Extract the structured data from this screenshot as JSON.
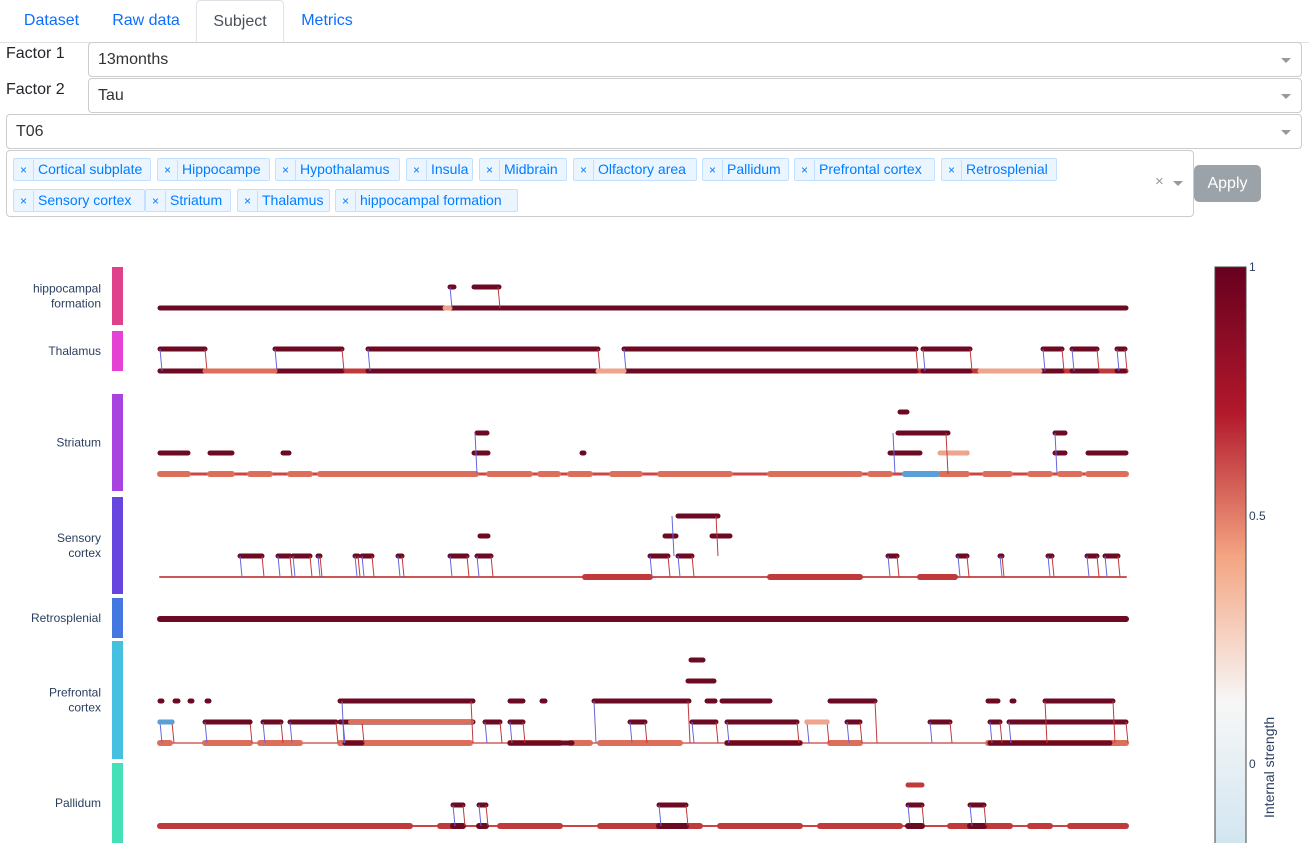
{
  "tabs": [
    {
      "label": "Dataset",
      "active": false
    },
    {
      "label": "Raw data",
      "active": false
    },
    {
      "label": "Subject",
      "active": true
    },
    {
      "label": "Metrics",
      "active": false
    }
  ],
  "filters": {
    "factor1": {
      "label": "Factor 1",
      "value": "13months"
    },
    "factor2": {
      "label": "Factor 2",
      "value": "Tau"
    },
    "subject": {
      "value": "T06"
    }
  },
  "regions": {
    "chips": [
      "Cortical subplate",
      "Hippocampe",
      "Hypothalamus",
      "Insula",
      "Midbrain",
      "Olfactory area",
      "Pallidum",
      "Prefrontal cortex",
      "Retrosplenial",
      "Sensory cortex",
      "Striatum",
      "Thalamus",
      "hippocampal formation"
    ],
    "remove_glyph": "×",
    "clear_glyph": "×"
  },
  "apply_button": {
    "label": "Apply",
    "disabled": true
  },
  "chart_data": {
    "type": "arc-track",
    "rows": [
      {
        "label_lines": [
          "hippocampal",
          "formation"
        ],
        "color": "#e0418b"
      },
      {
        "label_lines": [
          "Thalamus"
        ],
        "color": "#e442d2"
      },
      {
        "label_lines": [
          "Striatum"
        ],
        "color": "#a943e0"
      },
      {
        "label_lines": [
          "Sensory",
          "cortex"
        ],
        "color": "#6746e0"
      },
      {
        "label_lines": [
          "Retrosplenial"
        ],
        "color": "#4477e0"
      },
      {
        "label_lines": [
          "Prefrontal",
          "cortex"
        ],
        "color": "#45c0e0"
      },
      {
        "label_lines": [
          "Pallidum"
        ],
        "color": "#45e0b6"
      }
    ],
    "colorbar": {
      "title": "Internal strength",
      "ticks": [
        "1",
        "0.5",
        "0"
      ],
      "colors": [
        "#67001f",
        "#b2182b",
        "#f4a582",
        "#f7f7f7",
        "#d1e5f0"
      ]
    }
  }
}
